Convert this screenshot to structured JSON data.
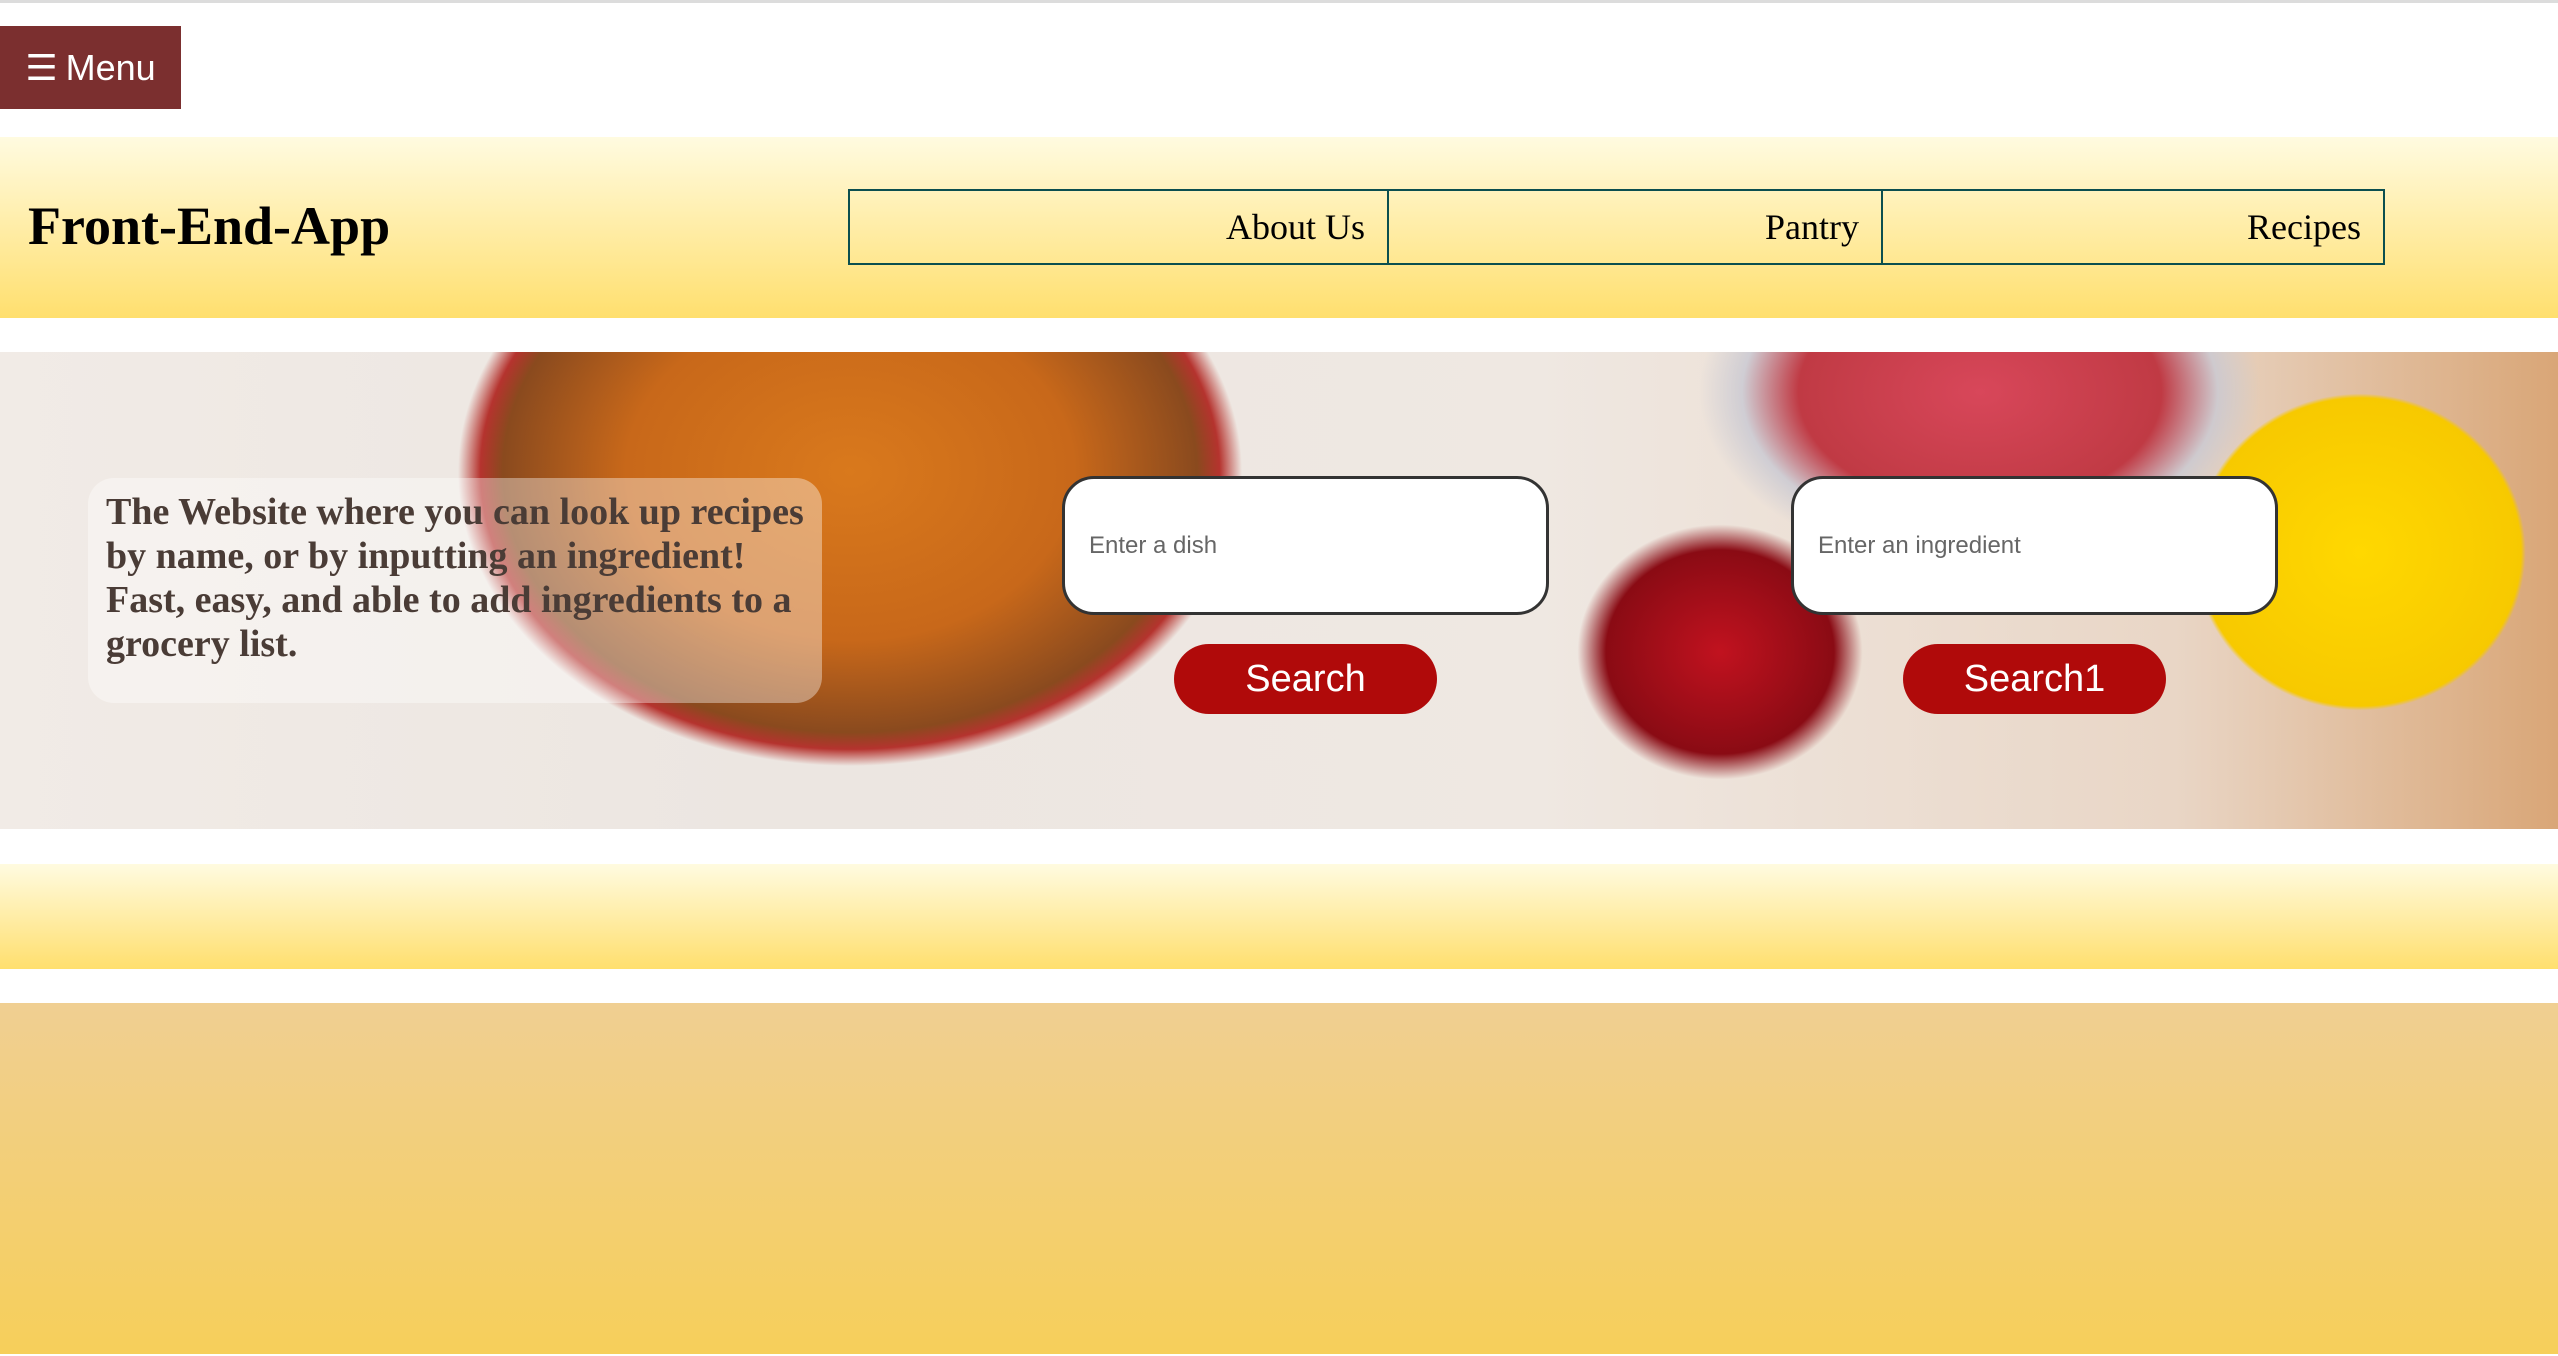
{
  "menu": {
    "icon": "hamburger-icon",
    "icon_glyph": "☰",
    "label": "Menu",
    "color": "#7b2f2f"
  },
  "header": {
    "title": "Front-End-App",
    "nav": [
      {
        "label": "About Us"
      },
      {
        "label": "Pantry"
      },
      {
        "label": "Recipes"
      }
    ]
  },
  "hero": {
    "description": "The Website where you can look up recipes by name, or by inputting an ingredient! Fast, easy, and able to add ingredients to a grocery list.",
    "dish_search": {
      "placeholder": "Enter a dish",
      "value": "",
      "button_label": "Search"
    },
    "ingredient_search": {
      "placeholder": "Enter an ingredient",
      "value": "",
      "button_label": "Search1"
    },
    "button_color": "#b00a0a"
  }
}
